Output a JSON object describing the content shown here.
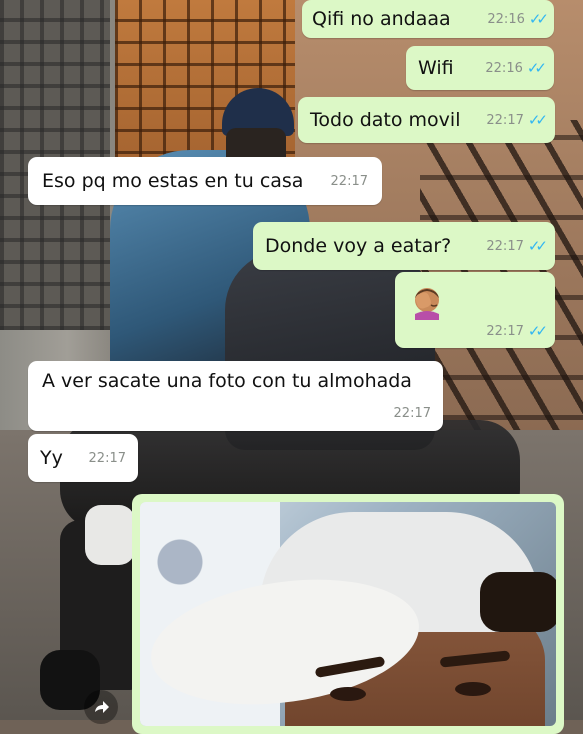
{
  "chat": {
    "messages": [
      {
        "id": "m1",
        "direction": "outgoing",
        "text": "Qifi no andaaa",
        "time": "22:16",
        "status": "read"
      },
      {
        "id": "m2",
        "direction": "outgoing",
        "text": "Wifi",
        "time": "22:16",
        "status": "read"
      },
      {
        "id": "m3",
        "direction": "outgoing",
        "text": "Todo dato movil",
        "time": "22:17",
        "status": "read"
      },
      {
        "id": "m4",
        "direction": "incoming",
        "text": "Eso pq mo estas en tu casa",
        "time": "22:17"
      },
      {
        "id": "m5",
        "direction": "outgoing",
        "text": "Donde voy a eatar?",
        "time": "22:17",
        "status": "read"
      },
      {
        "id": "m6",
        "direction": "outgoing",
        "emoji": "face-palm",
        "time": "22:17",
        "status": "read"
      },
      {
        "id": "m7",
        "direction": "incoming",
        "text": "A ver sacate una foto con tu almohada",
        "time": "22:17"
      },
      {
        "id": "m8",
        "direction": "incoming",
        "text": "Yy",
        "time": "22:17"
      },
      {
        "id": "m9",
        "direction": "outgoing",
        "type": "image"
      }
    ],
    "read_ticks": "✓✓"
  },
  "colors": {
    "outgoing_bubble": "#dcf8c6",
    "incoming_bubble": "#ffffff",
    "read_ticks": "#34b7f1",
    "timestamp": "#8a8f8a"
  },
  "icons": {
    "share": "share-arrow-icon",
    "emoji": "face-palm-emoji-icon"
  }
}
